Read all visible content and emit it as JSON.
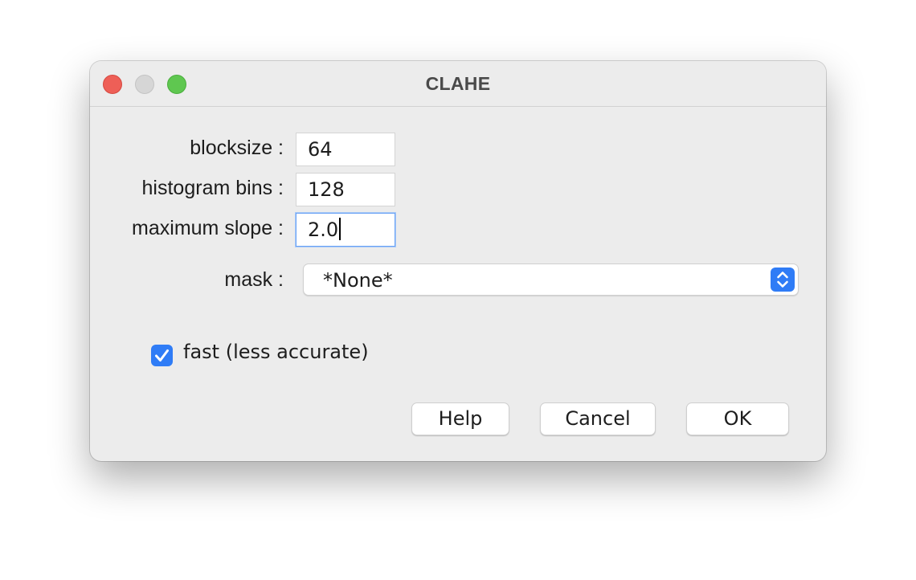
{
  "window": {
    "title": "CLAHE"
  },
  "form": {
    "blocksize": {
      "label": "blocksize :",
      "value": "64"
    },
    "histogram_bins": {
      "label": "histogram bins :",
      "value": "128"
    },
    "maximum_slope": {
      "label": "maximum slope :",
      "value": "2.0"
    },
    "mask": {
      "label": "mask :",
      "selected": "*None*"
    },
    "fast": {
      "label": "fast (less accurate)",
      "checked": true
    }
  },
  "buttons": {
    "help": "Help",
    "cancel": "Cancel",
    "ok": "OK"
  },
  "colors": {
    "accent": "#2f7cf6",
    "close": "#ee5f57",
    "minimize_disabled": "#d6d6d6",
    "maximize": "#5fc750",
    "window_bg": "#ececec"
  },
  "icons": {
    "select_arrows": "chevron-up-down-icon",
    "checkmark": "checkmark-icon"
  }
}
